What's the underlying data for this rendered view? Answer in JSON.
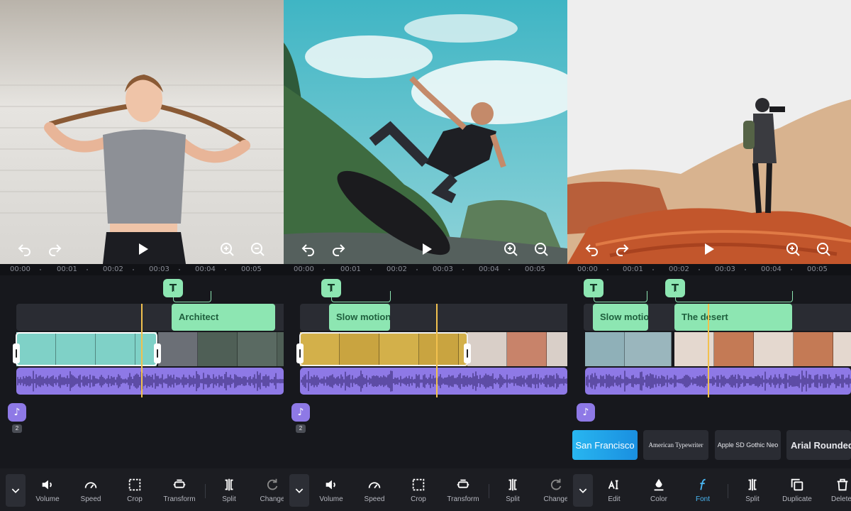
{
  "ruler_labels": [
    "00:00",
    "00:01",
    "00:02",
    "00:03",
    "00:04",
    "00:05"
  ],
  "panels": [
    {
      "text_clips": [
        {
          "label": "Architect"
        }
      ],
      "music_count": "2",
      "tools": [
        {
          "label": "Volume",
          "icon": "volume-icon"
        },
        {
          "label": "Speed",
          "icon": "speed-icon"
        },
        {
          "label": "Crop",
          "icon": "crop-icon"
        },
        {
          "label": "Transform",
          "icon": "transform-icon"
        },
        {
          "label": "Split",
          "icon": "split-icon"
        },
        {
          "label": "Change",
          "icon": "change-icon"
        }
      ]
    },
    {
      "text_clips": [
        {
          "label": "Slow motion"
        }
      ],
      "music_count": "2",
      "tools": [
        {
          "label": "Volume",
          "icon": "volume-icon"
        },
        {
          "label": "Speed",
          "icon": "speed-icon"
        },
        {
          "label": "Crop",
          "icon": "crop-icon"
        },
        {
          "label": "Transform",
          "icon": "transform-icon"
        },
        {
          "label": "Split",
          "icon": "split-icon"
        },
        {
          "label": "Change",
          "icon": "change-icon"
        }
      ]
    },
    {
      "text_clips": [
        {
          "label": "Slow motion"
        },
        {
          "label": "The desert"
        }
      ],
      "fonts": [
        "San Francisco",
        "American Typewriter",
        "Apple SD Gothic Neo",
        "Arial Rounded"
      ],
      "active_font": "San Francisco",
      "tools": [
        {
          "label": "Edit",
          "icon": "text-edit-icon"
        },
        {
          "label": "Color",
          "icon": "color-drop-icon"
        },
        {
          "label": "Font",
          "icon": "font-icon",
          "active": true
        },
        {
          "label": "Split",
          "icon": "split-icon"
        },
        {
          "label": "Duplicate",
          "icon": "duplicate-icon"
        },
        {
          "label": "Delete",
          "icon": "trash-icon"
        }
      ]
    }
  ],
  "colors": {
    "text_clip": "#8de6b2",
    "audio": "#8e79e6",
    "playhead": "#f2c14e",
    "active": "#4ab8f5"
  }
}
